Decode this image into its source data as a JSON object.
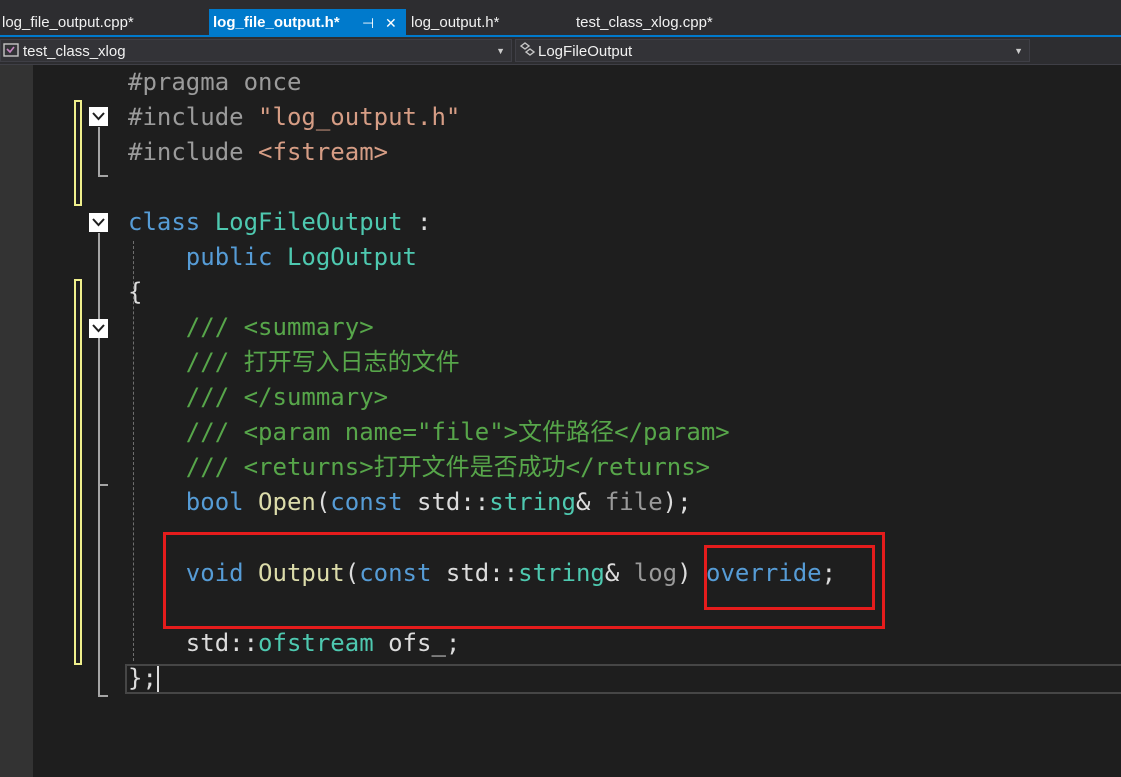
{
  "tabs": [
    {
      "label": "log_file_output.cpp*",
      "active": false
    },
    {
      "label": "log_file_output.h*",
      "active": true
    },
    {
      "label": "log_output.h*",
      "active": false
    },
    {
      "label": "test_class_xlog.cpp*",
      "active": false
    }
  ],
  "tab_icons": {
    "pin": "pin-icon",
    "close": "close-icon"
  },
  "nav": {
    "project": "test_class_xlog",
    "class": "LogFileOutput",
    "project_icon": "project-icon",
    "class_icon": "class-icon"
  },
  "code": {
    "l1": {
      "a": "#pragma once"
    },
    "l2": {
      "a": "#include ",
      "b": "\"log_output.h\""
    },
    "l3": {
      "a": "#include ",
      "b": "<fstream>"
    },
    "l5": {
      "a": "class",
      "b": " ",
      "c": "LogFileOutput",
      "d": " :"
    },
    "l6": {
      "a": "    ",
      "b": "public",
      "c": " ",
      "d": "LogOutput"
    },
    "l7": {
      "a": "{"
    },
    "l8": {
      "a": "    /// <summary>"
    },
    "l9": {
      "a": "    /// 打开写入日志的文件"
    },
    "l10": {
      "a": "    /// </summary>"
    },
    "l11": {
      "a": "    /// <param name=\"file\">文件路径</param>"
    },
    "l12": {
      "a": "    /// <returns>打开文件是否成功</returns>"
    },
    "l13": {
      "a": "    ",
      "b": "bool",
      "c": " ",
      "d": "Open",
      "e": "(",
      "f": "const",
      "g": " std::",
      "h": "string",
      "i": "& ",
      "j": "file",
      "k": ");"
    },
    "l15": {
      "a": "    ",
      "b": "void",
      "c": " ",
      "d": "Output",
      "e": "(",
      "f": "const",
      "g": " std::",
      "h": "string",
      "i": "& ",
      "j": "log",
      "k": ") ",
      "l": "override",
      "m": ";"
    },
    "l17": {
      "a": "    std::",
      "b": "ofstream",
      "c": " ofs_;"
    },
    "l18": {
      "a": "};"
    }
  },
  "colors": {
    "accent": "#007acc",
    "keyword": "#569cd6",
    "type": "#4ec9b0",
    "function": "#dcdcaa",
    "comment": "#57a64a",
    "string": "#d69d85",
    "highlight": "#e51c1c"
  }
}
